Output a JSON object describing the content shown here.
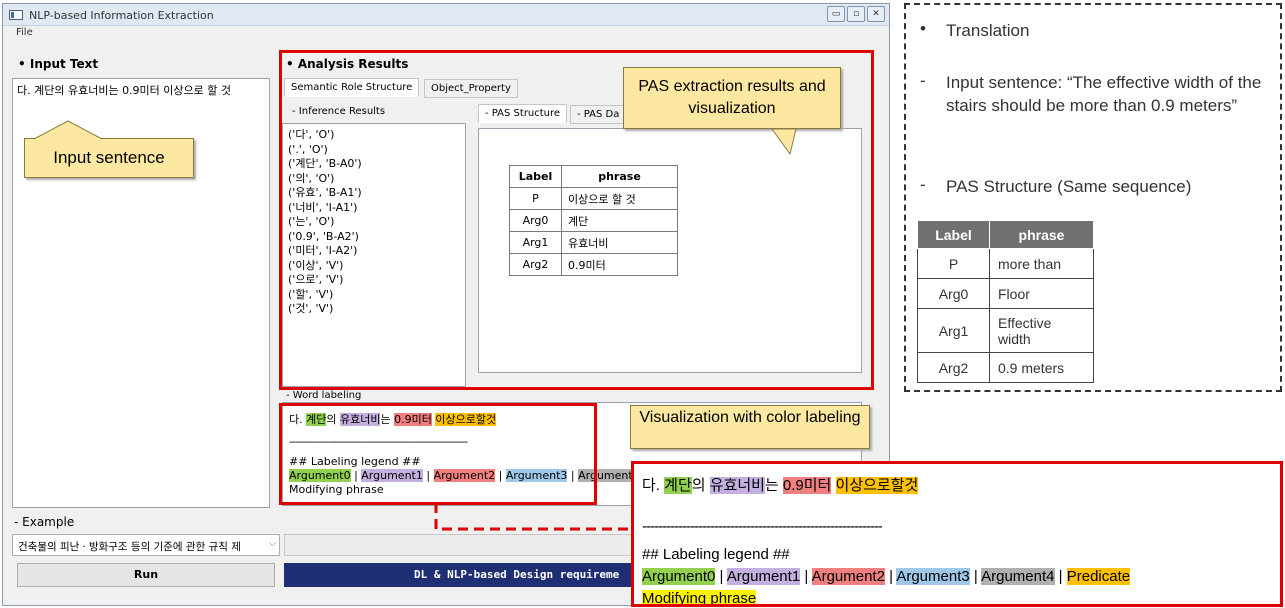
{
  "window": {
    "title": "NLP-based Information Extraction",
    "menu_file": "File",
    "min": "▭",
    "max": "▫",
    "close": "✕"
  },
  "input": {
    "section_label": "• Input Text",
    "text": "다. 계단의 유효너비는 0.9미터 이상으로 할 것",
    "callout": "Input sentence"
  },
  "example": {
    "label": "- Example",
    "selected": "건축물의 피난ㆍ방화구조 등의 기준에 관한 규칙 제",
    "arrow": "⌵",
    "run_label": "Run",
    "status_text": "DL & NLP-based Design requireme"
  },
  "analysis": {
    "section_label": "• Analysis Results",
    "tabs": [
      "Semantic Role Structure",
      "Object_Property"
    ],
    "inference_label": "- Inference Results",
    "inference_lines": [
      "('다', 'O')",
      "('.', 'O')",
      "('계단', 'B-A0')",
      "('의', 'O')",
      "('유효', 'B-A1')",
      "('너비', 'I-A1')",
      "('는', 'O')",
      "('0.9', 'B-A2')",
      "('미터', 'I-A2')",
      "('이상', 'V')",
      "('으로', 'V')",
      "('할', 'V')",
      "('것', 'V')"
    ],
    "sub_tabs": [
      "- PAS Structure",
      "- PAS Da"
    ],
    "pas_headers": [
      "Label",
      "phrase"
    ],
    "pas_rows": [
      {
        "label": "P",
        "phrase": "이상으로 할 것"
      },
      {
        "label": "Arg0",
        "phrase": "계단"
      },
      {
        "label": "Arg1",
        "phrase": "유효너비"
      },
      {
        "label": "Arg2",
        "phrase": "0.9미터"
      }
    ],
    "callout": "PAS extraction results and visualization"
  },
  "word_labeling": {
    "label": "- Word labeling",
    "seg": [
      "다. ",
      "계단",
      "의 ",
      "유효너비",
      "는 ",
      "0.9미터",
      " ",
      "이상으로할것"
    ],
    "dashes": "------------------------------------------------------------",
    "legend_title": "## Labeling legend ##",
    "legend": [
      "Argument0",
      " | ",
      "Argument1",
      " | ",
      "Argument2",
      " | ",
      "Argument3",
      " | ",
      "Argument4",
      " | ",
      "Predicate"
    ],
    "legend_short": "Argument4",
    "modifying": "Modifying phrase",
    "callout": "Visualization with color labeling"
  },
  "translation": {
    "bullet": "•",
    "dash": "-",
    "heading": "Translation",
    "sentence": "Input sentence: “The effective width of the stairs should be more than 0.9 meters”",
    "pas_heading": "PAS Structure (Same sequence)",
    "headers": [
      "Label",
      "phrase"
    ],
    "rows": [
      {
        "label": "P",
        "phrase": "more than"
      },
      {
        "label": "Arg0",
        "phrase": "Floor"
      },
      {
        "label": "Arg1",
        "phrase": "Effective width"
      },
      {
        "label": "Arg2",
        "phrase": "0.9 meters"
      }
    ]
  },
  "colors": {
    "highlight_red": "#e00000",
    "callout_fill": "#fce8a0",
    "status_bar": "#1f2f73",
    "arg0": "#92d050",
    "arg1": "#c4b0e0",
    "arg2": "#f08080",
    "arg3": "#9fc8e8",
    "arg4": "#b0b0b0",
    "predicate": "#ffc000"
  }
}
